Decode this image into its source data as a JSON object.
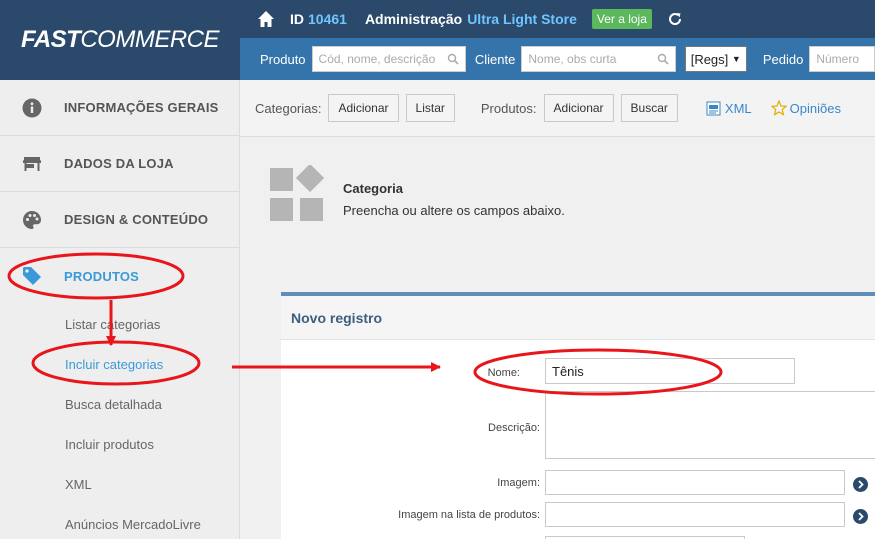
{
  "brand": {
    "logo_fast": "FAST",
    "logo_commerce": "COMMERCE"
  },
  "topbar": {
    "id_label": "ID",
    "id_value": "10461",
    "admin_label": "Administração",
    "store_name": "Ultra Light Store",
    "ver_loja": "Ver a loja"
  },
  "search": {
    "produto_label": "Produto",
    "produto_placeholder": "Cód, nome, descrição",
    "cliente_label": "Cliente",
    "cliente_placeholder": "Nome, obs curta",
    "regs": "[Regs]",
    "pedido_label": "Pedido",
    "pedido_placeholder": "Número"
  },
  "sidebar": {
    "items": [
      {
        "label": "INFORMAÇÕES GERAIS",
        "icon": "info-icon"
      },
      {
        "label": "DADOS DA LOJA",
        "icon": "store-icon"
      },
      {
        "label": "DESIGN & CONTEÚDO",
        "icon": "palette-icon"
      },
      {
        "label": "PRODUTOS",
        "icon": "tag-icon"
      }
    ],
    "subitems": [
      {
        "label": "Listar categorias"
      },
      {
        "label": "Incluir categorias"
      },
      {
        "label": "Busca detalhada"
      },
      {
        "label": "Incluir produtos"
      },
      {
        "label": "XML"
      },
      {
        "label": "Anúncios MercadoLivre"
      }
    ]
  },
  "actionbar": {
    "categorias_label": "Categorias:",
    "adicionar": "Adicionar",
    "listar": "Listar",
    "produtos_label": "Produtos:",
    "adicionar2": "Adicionar",
    "buscar": "Buscar",
    "xml": "XML",
    "opinioes": "Opiniões"
  },
  "page": {
    "title": "Categoria",
    "subtitle": "Preencha ou altere os campos abaixo."
  },
  "form": {
    "panel_title": "Novo registro",
    "nome_label": "Nome:",
    "nome_value": "Tênis",
    "descricao_label": "Descrição:",
    "imagem_label": "Imagem:",
    "imagem_lista_label": "Imagem na lista de produtos:"
  },
  "colors": {
    "header_dark": "#2b4a6b",
    "header_blue": "#3574ab",
    "accent": "#3a9ad9",
    "green": "#5cb85c",
    "annotation_red": "#e8151b"
  }
}
